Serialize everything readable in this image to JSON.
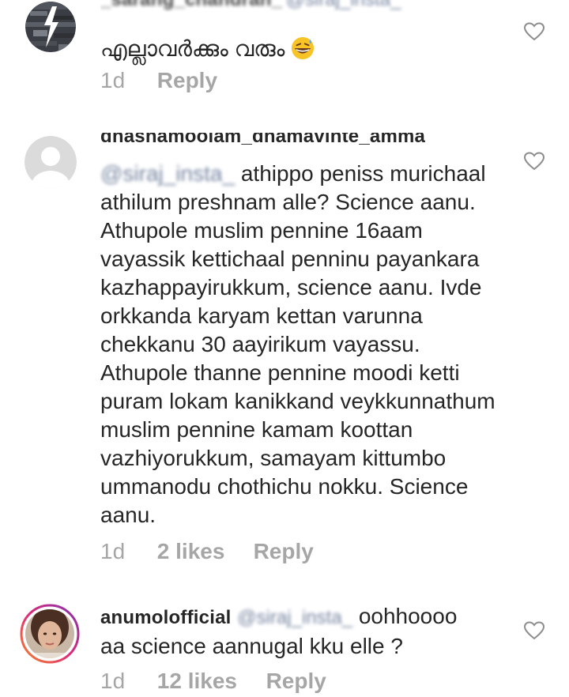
{
  "comments": [
    {
      "username": "_sarang_chandran_",
      "mention": "@siraj_insta_",
      "text": "എല്ലാവർക്കും വരും",
      "emoji": "grinning-sweat-emoji",
      "time": "1d",
      "likes": "",
      "reply": "Reply",
      "avatar": "glitch-avatar"
    },
    {
      "username": "dhashamoolam_dhamavinte_amma",
      "mention": "@siraj_insta_",
      "text_first": "athippo peniss murichaal",
      "text_lines": [
        "athilum preshnam alle? Science aanu.",
        "Athupole muslim pennine 16aam",
        "vayassik kettichaal penninu payankara",
        "kazhappayirukkum, science aanu. Ivde",
        "orkkanda karyam kettan varunna",
        "chekkanu 30 aayirikum vayassu.",
        "Athupole thanne pennine moodi ketti",
        "puram lokam kanikkand veykkunnathum",
        "muslim pennine kamam koottan",
        "vazhiyorukkum, samayam kittumbo",
        "ummanodu chothichu nokku. Science",
        "aanu."
      ],
      "time": "1d",
      "likes": "2 likes",
      "reply": "Reply",
      "avatar": "default-avatar"
    },
    {
      "username": "anumolofficial",
      "mention": "@siraj_insta_",
      "text_first": "oohhoooo",
      "text_lines": [
        "aa science aannugal kku elle ?"
      ],
      "time": "1d",
      "likes": "12 likes",
      "reply": "Reply",
      "avatar": "profile-photo-avatar"
    }
  ],
  "colors": {
    "text": "#262626",
    "meta": "#a6a6a6",
    "mention": "#5e6f8f",
    "heart": "#8e8e8e",
    "story_ring": "#c13584"
  }
}
